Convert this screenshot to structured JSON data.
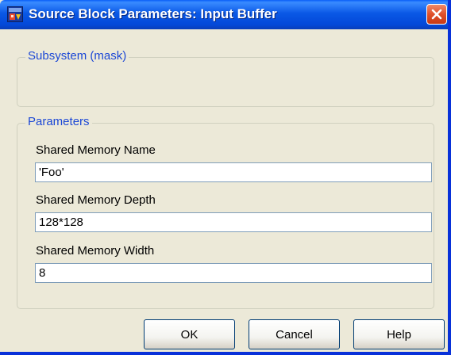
{
  "window": {
    "title": "Source Block Parameters: Input Buffer"
  },
  "subsystem": {
    "legend": "Subsystem (mask)"
  },
  "parameters": {
    "legend": "Parameters",
    "fields": [
      {
        "label": "Shared Memory Name",
        "value": "'Foo'"
      },
      {
        "label": "Shared Memory Depth",
        "value": "128*128"
      },
      {
        "label": "Shared Memory Width",
        "value": "8"
      }
    ]
  },
  "buttons": {
    "ok": "OK",
    "cancel": "Cancel",
    "help": "Help"
  },
  "icons": {
    "title": "simulink-block-icon",
    "close": "close-icon"
  }
}
